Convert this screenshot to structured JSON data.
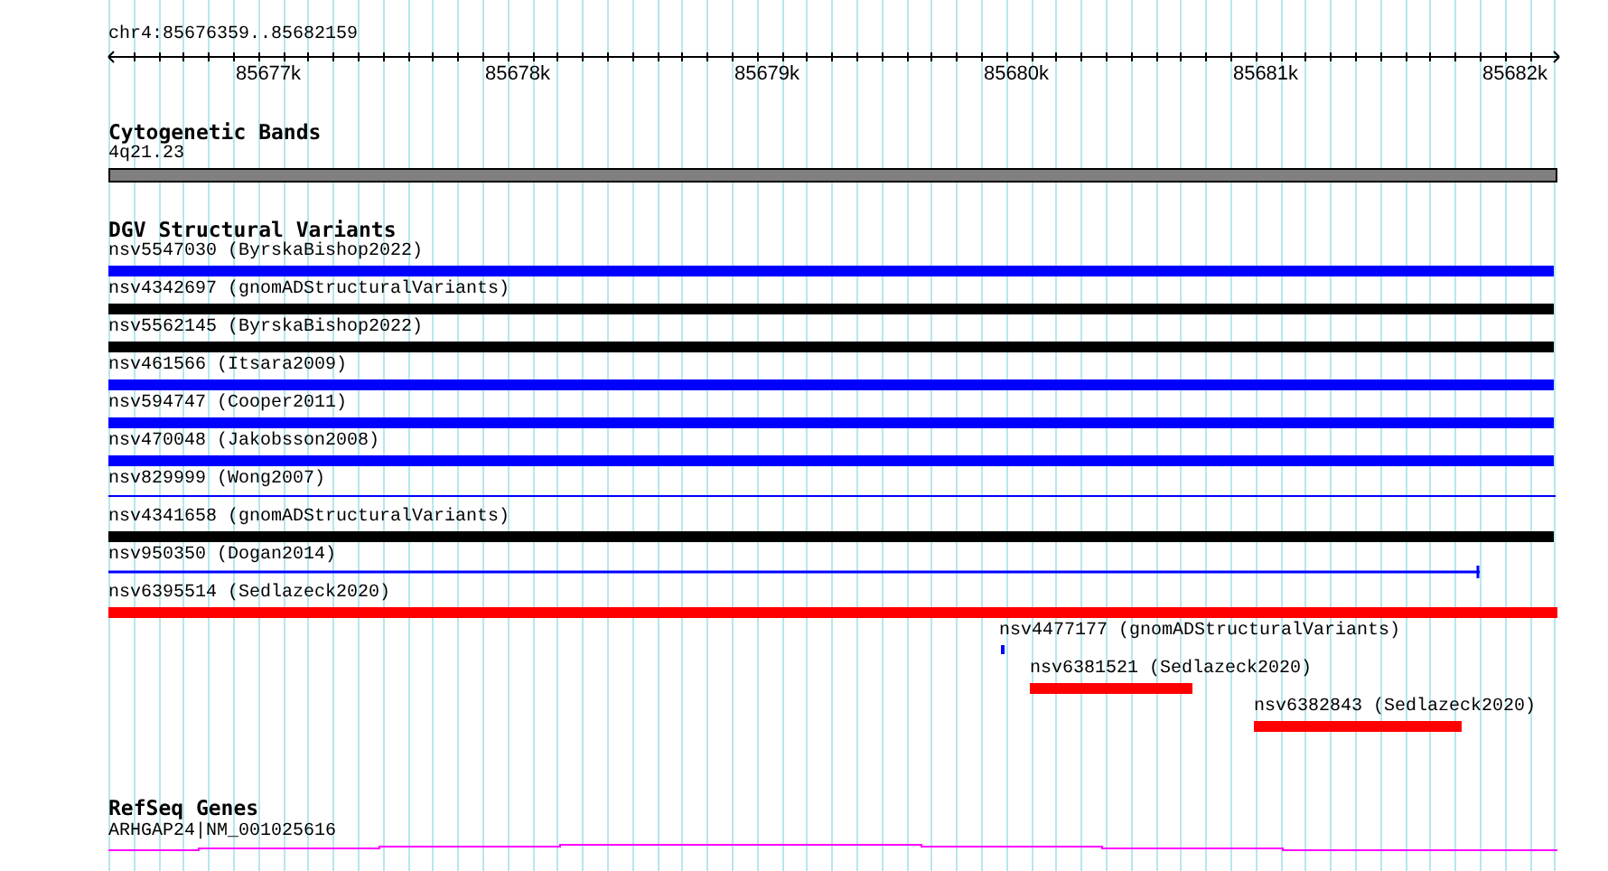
{
  "ruler": {
    "location": "chr4:85676359..85682159",
    "ticks": [
      "85677k",
      "85678k",
      "85679k",
      "85680k",
      "85681k",
      "85682k"
    ]
  },
  "tracks": [
    {
      "title": "Cytogenetic Bands",
      "kind": "bands",
      "features": [
        {
          "label": "4q21.23"
        }
      ]
    },
    {
      "title": "DGV Structural Variants",
      "kind": "variants",
      "features": [
        {
          "label": "nsv5547030 (ByrskaBishop2022)",
          "kind": "bar",
          "color": "#0000ff"
        },
        {
          "label": "nsv4342697 (gnomADStructuralVariants)",
          "kind": "bar",
          "color": "#000000"
        },
        {
          "label": "nsv5562145 (ByrskaBishop2022)",
          "kind": "bar",
          "color": "#000000"
        },
        {
          "label": "nsv461566 (Itsara2009)",
          "kind": "bar",
          "color": "#0000ff"
        },
        {
          "label": "nsv594747 (Cooper2011)",
          "kind": "bar",
          "color": "#0000ff"
        },
        {
          "label": "nsv470048 (Jakobsson2008)",
          "kind": "bar",
          "color": "#0000ff"
        },
        {
          "label": "nsv829999 (Wong2007)",
          "kind": "line",
          "color": "#0000ff"
        },
        {
          "label": "nsv4341658 (gnomADStructuralVariants)",
          "kind": "bar",
          "color": "#000000"
        },
        {
          "label": "nsv950350 (Dogan2014)",
          "kind": "line",
          "color": "#0000ff"
        },
        {
          "label": "nsv6395514 (Sedlazeck2020)",
          "kind": "bar",
          "color": "#ff0000"
        },
        {
          "label": "nsv4477177 (gnomADStructuralVariants)",
          "kind": "bar",
          "color": "#0000ff"
        },
        {
          "label": "nsv6381521 (Sedlazeck2020)",
          "kind": "bar",
          "color": "#ff0000"
        },
        {
          "label": "nsv6382843 (Sedlazeck2020)",
          "kind": "bar",
          "color": "#ff0000"
        }
      ]
    },
    {
      "title": "RefSeq Genes",
      "kind": "genes",
      "features": [
        {
          "label": "ARHGAP24|NM_001025616"
        }
      ]
    }
  ]
}
